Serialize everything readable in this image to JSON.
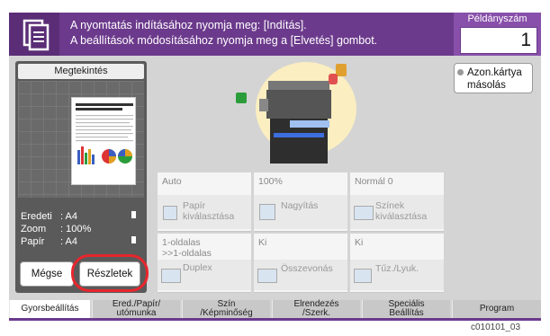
{
  "header": {
    "line1": "A nyomtatás indításához nyomja meg: [Indítás].",
    "line2": "A beállítások módosításához nyomja meg a [Elvetés] gombot.",
    "copies_label": "Példányszám",
    "copies_value": "1"
  },
  "preview": {
    "title": "Megtekintés",
    "info": [
      {
        "key": "Eredeti",
        "value": ": A4"
      },
      {
        "key": "Zoom",
        "value": ": 100%"
      },
      {
        "key": "Papír",
        "value": ": A4"
      }
    ],
    "cancel_label": "Mégse",
    "details_label": "Részletek"
  },
  "id_card_button": {
    "line1": "Azon.kártya",
    "line2": "másolás"
  },
  "quick_settings": [
    {
      "value": "Auto",
      "label": "Papír\nkiválasztása",
      "icon": "paper-icon"
    },
    {
      "value": "100%",
      "label": "Nagyítás",
      "icon": "zoom-icon"
    },
    {
      "value": "Normál 0",
      "label": "Színek\nkiválasztása",
      "icon": "color-icon"
    },
    {
      "value": "1-oldalas\n>>1-oldalas",
      "label": "Duplex",
      "icon": "duplex-icon"
    },
    {
      "value": "Ki",
      "label": "Összevonás",
      "icon": "combine-icon"
    },
    {
      "value": "Ki",
      "label": "Tűz./Lyuk.",
      "icon": "staple-icon"
    }
  ],
  "tabs": [
    {
      "label": "Gyorsbeállítás",
      "active": true
    },
    {
      "label": "Ered./Papír/\nutómunka",
      "active": false
    },
    {
      "label": "Szín\n/Képminőség",
      "active": false
    },
    {
      "label": "Elrendezés\n/Szerk.",
      "active": false
    },
    {
      "label": "Speciális\nBeállítás",
      "active": false
    },
    {
      "label": "Program",
      "active": false
    }
  ],
  "image_code": "c010101_03",
  "colors": {
    "header": "#6c3a8c",
    "highlight": "#e8262d"
  }
}
